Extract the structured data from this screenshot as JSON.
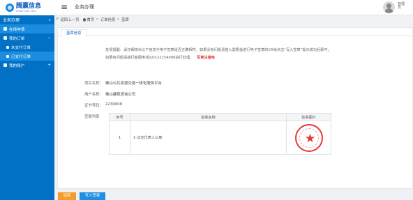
{
  "app": {
    "brand": "腾赢信息",
    "brand_sub": "enuo-cert.com",
    "top_title": "业务办理",
    "user": [
      "管理",
      "员"
    ]
  },
  "sidebar": {
    "section": "业务办理",
    "items": [
      {
        "label": "在线申请"
      },
      {
        "label": "我的订单"
      },
      {
        "label": "未支付订单"
      },
      {
        "label": "已支付订单"
      },
      {
        "label": "我的账户"
      }
    ]
  },
  "breadcrumb": {
    "back": "返回上一页",
    "home": "首页",
    "order": "订单信息",
    "current": "盖章"
  },
  "tab": "盖章信息",
  "notice": {
    "line1": "友情提醒：请仔细核对以下信息与电子签章是否正确相符，如果没有问题请插入需要盖进行电子签章的CA锁点击“写入签章”提示成功后即可，",
    "line2": "如果有问题请拨打客服电话020-22154006进行处理。",
    "red": "写章注意哈"
  },
  "fields": {
    "project_label": "项目名称：",
    "project_value": "佛山公共资源交易一体化服务平台",
    "user_label": "用户名称：",
    "user_value": "佛山建筑咨询公司",
    "cert_label": "证书号码：",
    "cert_value": "2230009",
    "list_label": "签章列表"
  },
  "table": {
    "headers": [
      "序号",
      "签章名称",
      "签章图片"
    ],
    "rows": [
      {
        "index": "1",
        "name": "1-法定代表人公章"
      }
    ]
  },
  "buttons": {
    "back": "返回",
    "write": "写入签章"
  },
  "colors": {
    "sidebar": "#0071c5",
    "primary": "#1f8fe0",
    "warning": "#f59b2b",
    "seal_red": "#e53935"
  }
}
